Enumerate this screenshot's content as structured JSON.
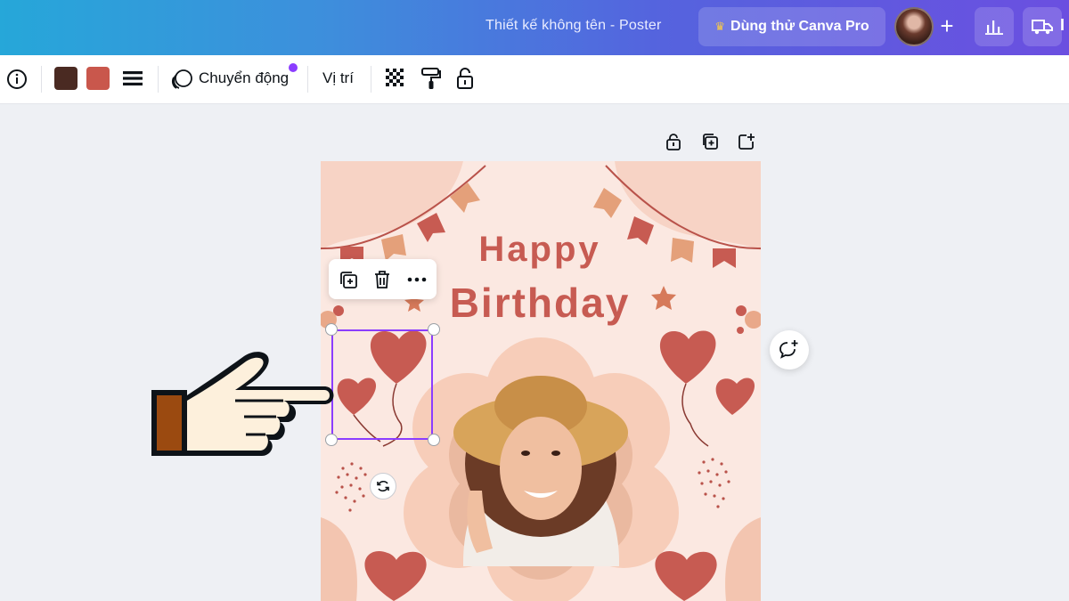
{
  "header": {
    "doc_title": "Thiết kế không tên - Poster",
    "pro_button": "Dùng thử Canva Pro",
    "truncated_text": "I"
  },
  "toolbar": {
    "info_icon": "info-icon",
    "color_swatches": [
      "#4a2a22",
      "#c9574c"
    ],
    "line_style_icon": "line-weight-icon",
    "animate_label": "Chuyển động",
    "position_label": "Vị trí",
    "transparency_icon": "transparency-icon",
    "copy_style_icon": "paint-roller-icon",
    "lock_icon": "lock-icon"
  },
  "poster": {
    "title_line1": "Happy",
    "title_line2": "Birthday",
    "colors": {
      "background": "#fbe8e1",
      "accent": "#c75b52",
      "flag_light": "#e4a07a",
      "petal": "#f3c5b0"
    }
  },
  "colors": {
    "selection": "#8b3dff",
    "notification_dot": "#8b3dff"
  }
}
